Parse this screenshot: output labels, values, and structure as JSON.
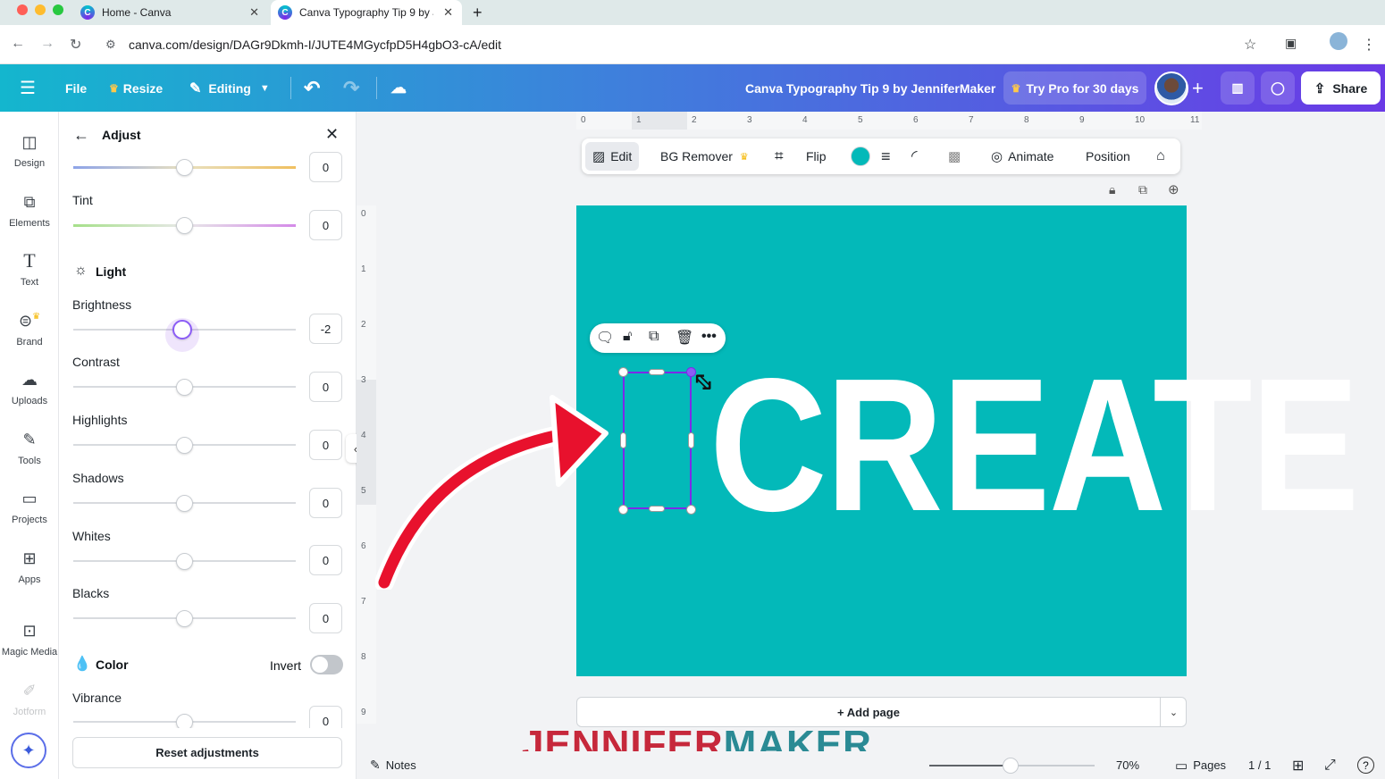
{
  "browser": {
    "tabs": [
      {
        "title": "Home - Canva"
      },
      {
        "title": "Canva Typography Tip 9 by J"
      }
    ],
    "url": "canva.com/design/DAGr9Dkmh-I/JUTE4MGycfpD5H4gbO3-cA/edit"
  },
  "header": {
    "file": "File",
    "resize": "Resize",
    "editing": "Editing",
    "doc_title": "Canva Typography Tip 9 by JenniferMaker",
    "try_pro": "Try Pro for 30 days",
    "share": "Share"
  },
  "rail": {
    "items": [
      {
        "label": "Design",
        "icon": "design-icon"
      },
      {
        "label": "Elements",
        "icon": "elements-icon"
      },
      {
        "label": "Text",
        "icon": "text-icon"
      },
      {
        "label": "Brand",
        "icon": "brand-icon"
      },
      {
        "label": "Uploads",
        "icon": "uploads-icon"
      },
      {
        "label": "Tools",
        "icon": "tools-icon"
      },
      {
        "label": "Projects",
        "icon": "projects-icon"
      },
      {
        "label": "Apps",
        "icon": "apps-icon"
      },
      {
        "label": "Magic Media",
        "icon": "magic-media-icon"
      },
      {
        "label": "Jotform",
        "icon": "jotform-icon"
      }
    ]
  },
  "panel": {
    "title": "Adjust",
    "top_slider_value": "0",
    "tint": {
      "label": "Tint",
      "value": "0"
    },
    "light_section": "Light",
    "sliders": [
      {
        "label": "Brightness",
        "value": "-2"
      },
      {
        "label": "Contrast",
        "value": "0"
      },
      {
        "label": "Highlights",
        "value": "0"
      },
      {
        "label": "Shadows",
        "value": "0"
      },
      {
        "label": "Whites",
        "value": "0"
      },
      {
        "label": "Blacks",
        "value": "0"
      }
    ],
    "color_section": "Color",
    "invert_label": "Invert",
    "invert_on": false,
    "vibrance": {
      "label": "Vibrance",
      "value": "0"
    },
    "reset": "Reset adjustments"
  },
  "context_toolbar": {
    "edit": "Edit",
    "bg_remover": "BG Remover",
    "flip": "Flip",
    "animate": "Animate",
    "position": "Position",
    "fill_color": "#03b9b9"
  },
  "ruler": {
    "h": [
      "0",
      "1",
      "2",
      "3",
      "4",
      "5",
      "6",
      "7",
      "8",
      "9",
      "10",
      "11"
    ],
    "v": [
      "0",
      "1",
      "2",
      "3",
      "4",
      "5",
      "6",
      "7",
      "8",
      "9"
    ]
  },
  "canvas": {
    "word": "CREATE",
    "bg_color": "#03b9b9",
    "add_page": "+ Add page"
  },
  "bottom": {
    "notes": "Notes",
    "zoom": "70%",
    "pages": "Pages",
    "page_count": "1 / 1"
  },
  "watermark": {
    "part1": "JENNIFER",
    "part2": "MAKER"
  }
}
